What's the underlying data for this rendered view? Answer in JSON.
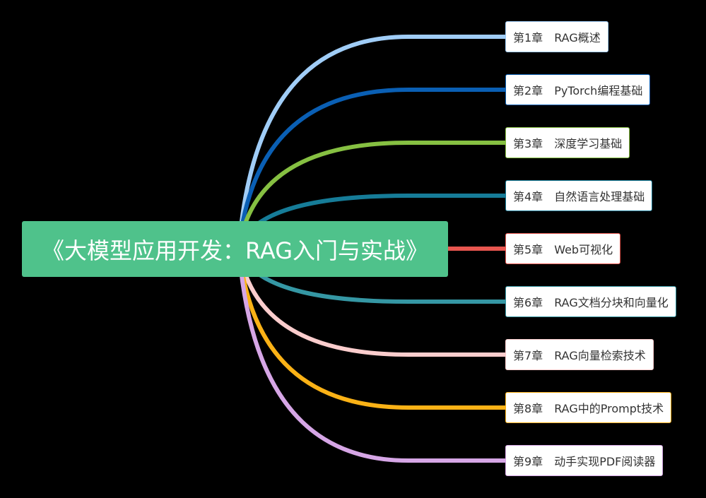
{
  "root": {
    "title": "《大模型应用开发：RAG入门与实战》",
    "color": "#4fc28b"
  },
  "chapters": [
    {
      "num": "第1章",
      "title": "RAG概述",
      "color": "#a0cdf7"
    },
    {
      "num": "第2章",
      "title": "PyTorch编程基础",
      "color": "#0a5fb4"
    },
    {
      "num": "第3章",
      "title": "深度学习基础",
      "color": "#86c042"
    },
    {
      "num": "第4章",
      "title": "自然语言处理基础",
      "color": "#167c98"
    },
    {
      "num": "第5章",
      "title": "Web可视化",
      "color": "#e8564f"
    },
    {
      "num": "第6章",
      "title": "RAG文档分块和向量化",
      "color": "#3597a4"
    },
    {
      "num": "第7章",
      "title": "RAG向量检索技术",
      "color": "#fbcdcd"
    },
    {
      "num": "第8章",
      "title": "RAG中的Prompt技术",
      "color": "#fbb216"
    },
    {
      "num": "第9章",
      "title": "动手实现PDF阅读器",
      "color": "#d6a6e6"
    }
  ]
}
